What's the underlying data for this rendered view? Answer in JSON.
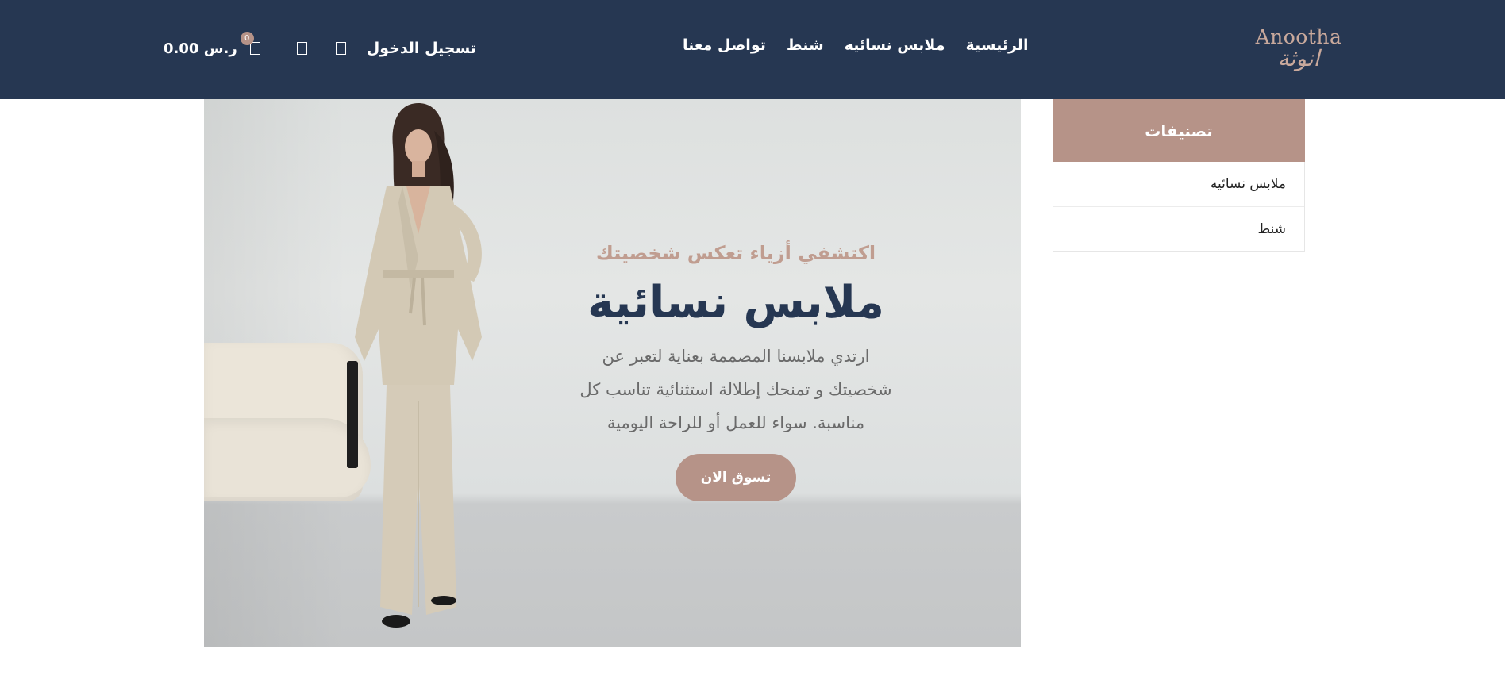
{
  "header": {
    "logo_latin": "Anootha",
    "logo_arabic": "انوثة",
    "nav": [
      {
        "label": "الرئيسية",
        "active": true
      },
      {
        "label": "ملابس نسائيه",
        "active": false
      },
      {
        "label": "شنط",
        "active": false
      },
      {
        "label": "تواصل معنا",
        "active": false
      }
    ],
    "login_label": "تسجيل الدخول",
    "cart_total": "0.00 ر.س",
    "cart_count": "0",
    "icons": [
      "cart-icon",
      "wishlist-icon",
      "search-icon"
    ]
  },
  "hero": {
    "eyebrow": "اكتشفي أزياء تعكس شخصيتك",
    "title": "ملابس نسائية",
    "desc_line1": "ارتدي ملابسنا المصممة بعناية لتعبر عن",
    "desc_line2": "شخصيتك و تمنحك إطلالة استثنائية تناسب كل",
    "desc_line3": "مناسبة. سواء للعمل أو للراحة اليومية",
    "button_label": "تسوق الان"
  },
  "sidebar": {
    "title": "تصنيفات",
    "items": [
      {
        "label": "ملابس نسائيه"
      },
      {
        "label": "شنط"
      }
    ]
  },
  "colors": {
    "header_bg": "#263752",
    "accent": "#b69388",
    "title": "#263752"
  }
}
